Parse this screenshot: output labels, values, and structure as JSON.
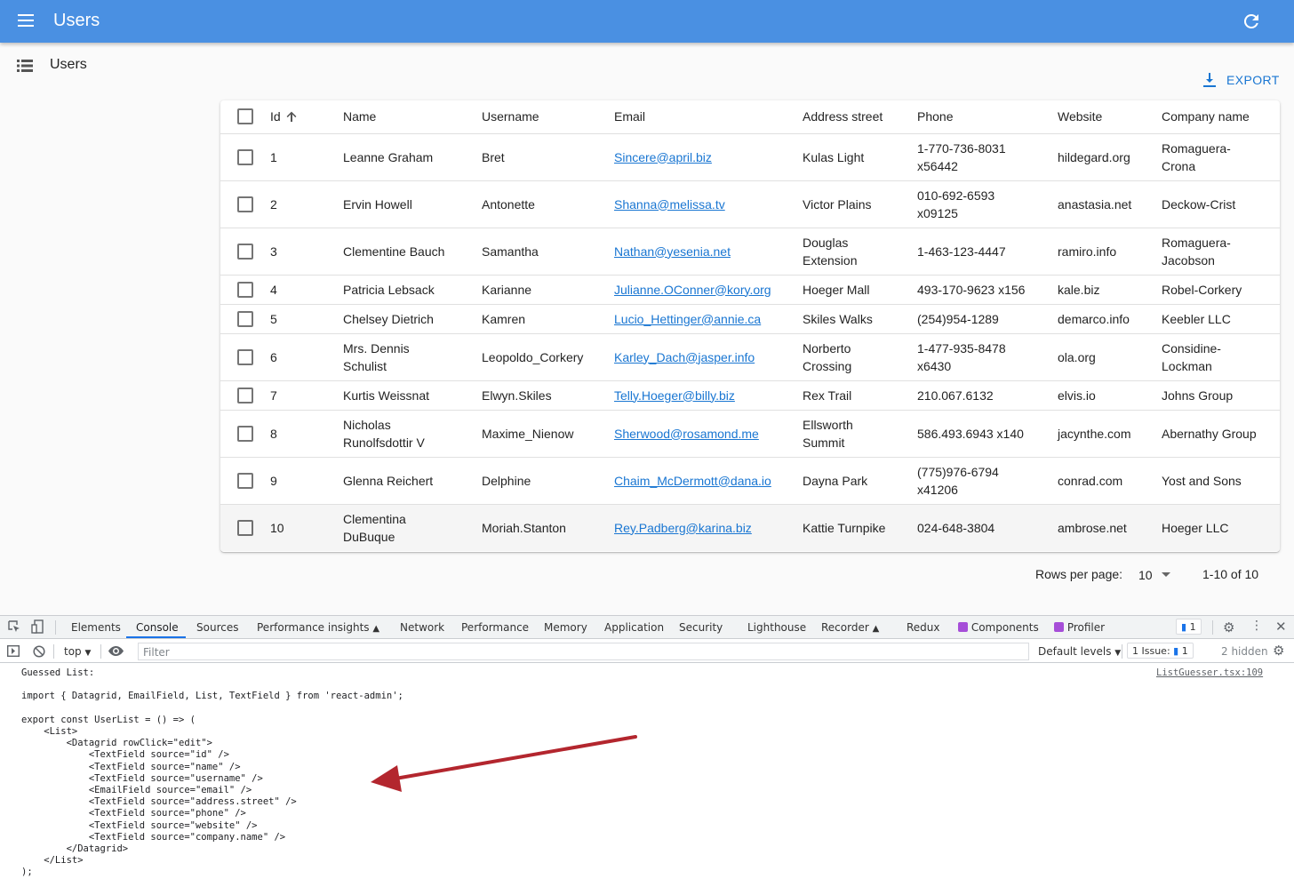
{
  "appbar": {
    "title": "Users",
    "color": "#4a90e2"
  },
  "page": {
    "title": "Users",
    "export_label": "EXPORT"
  },
  "table": {
    "columns": [
      "Id",
      "Name",
      "Username",
      "Email",
      "Address street",
      "Phone",
      "Website",
      "Company name"
    ],
    "rows": [
      {
        "id": "1",
        "name": [
          "Leanne Graham"
        ],
        "username": "Bret",
        "email": "Sincere@april.biz",
        "street": [
          "Kulas Light"
        ],
        "phone": [
          "1-770-736-8031",
          "x56442"
        ],
        "website": "hildegard.org",
        "company": [
          "Romaguera-",
          "Crona"
        ]
      },
      {
        "id": "2",
        "name": [
          "Ervin Howell"
        ],
        "username": "Antonette",
        "email": "Shanna@melissa.tv",
        "street": [
          "Victor Plains"
        ],
        "phone": [
          "010-692-6593",
          "x09125"
        ],
        "website": "anastasia.net",
        "company": [
          "Deckow-Crist"
        ]
      },
      {
        "id": "3",
        "name": [
          "Clementine Bauch"
        ],
        "username": "Samantha",
        "email": "Nathan@yesenia.net",
        "street": [
          "Douglas",
          "Extension"
        ],
        "phone": [
          "1-463-123-4447"
        ],
        "website": "ramiro.info",
        "company": [
          "Romaguera-",
          "Jacobson"
        ]
      },
      {
        "id": "4",
        "name": [
          "Patricia Lebsack"
        ],
        "username": "Karianne",
        "email": "Julianne.OConner@kory.org",
        "street": [
          "Hoeger Mall"
        ],
        "phone": [
          "493-170-9623 x156"
        ],
        "website": "kale.biz",
        "company": [
          "Robel-Corkery"
        ]
      },
      {
        "id": "5",
        "name": [
          "Chelsey Dietrich"
        ],
        "username": "Kamren",
        "email": "Lucio_Hettinger@annie.ca",
        "street": [
          "Skiles Walks"
        ],
        "phone": [
          "(254)954-1289"
        ],
        "website": "demarco.info",
        "company": [
          "Keebler LLC"
        ]
      },
      {
        "id": "6",
        "name": [
          "Mrs. Dennis",
          "Schulist"
        ],
        "username": "Leopoldo_Corkery",
        "email": "Karley_Dach@jasper.info",
        "street": [
          "Norberto",
          "Crossing"
        ],
        "phone": [
          "1-477-935-8478",
          "x6430"
        ],
        "website": "ola.org",
        "company": [
          "Considine-",
          "Lockman"
        ]
      },
      {
        "id": "7",
        "name": [
          "Kurtis Weissnat"
        ],
        "username": "Elwyn.Skiles",
        "email": "Telly.Hoeger@billy.biz",
        "street": [
          "Rex Trail"
        ],
        "phone": [
          "210.067.6132"
        ],
        "website": "elvis.io",
        "company": [
          "Johns Group"
        ]
      },
      {
        "id": "8",
        "name": [
          "Nicholas",
          "Runolfsdottir V"
        ],
        "username": "Maxime_Nienow",
        "email": "Sherwood@rosamond.me",
        "street": [
          "Ellsworth",
          "Summit"
        ],
        "phone": [
          "586.493.6943 x140"
        ],
        "website": "jacynthe.com",
        "company": [
          "Abernathy Group"
        ]
      },
      {
        "id": "9",
        "name": [
          "Glenna Reichert"
        ],
        "username": "Delphine",
        "email": "Chaim_McDermott@dana.io",
        "street": [
          "Dayna Park"
        ],
        "phone": [
          "(775)976-6794",
          "x41206"
        ],
        "website": "conrad.com",
        "company": [
          "Yost and Sons"
        ]
      },
      {
        "id": "10",
        "name": [
          "Clementina",
          "DuBuque"
        ],
        "username": "Moriah.Stanton",
        "email": "Rey.Padberg@karina.biz",
        "street": [
          "Kattie Turnpike"
        ],
        "phone": [
          "024-648-3804"
        ],
        "website": "ambrose.net",
        "company": [
          "Hoeger LLC"
        ]
      }
    ]
  },
  "pagination": {
    "rows_per_page_label": "Rows per page:",
    "rows_per_page_value": "10",
    "range": "1-10 of 10"
  },
  "devtools": {
    "tabs": [
      "Elements",
      "Console",
      "Sources",
      "Performance insights",
      "Network",
      "Performance",
      "Memory",
      "Application",
      "Security",
      "Lighthouse",
      "Recorder",
      "Redux",
      "Components",
      "Profiler"
    ],
    "messages_count": "1",
    "context": "top",
    "filter_placeholder": "Filter",
    "default_levels": "Default levels",
    "issues_label": "1 Issue:",
    "issues_count": "1",
    "hidden": "2 hidden",
    "source_link": "ListGuesser.tsx:109",
    "console_lines": [
      "Guessed List:",
      "",
      "import { Datagrid, EmailField, List, TextField } from 'react-admin';",
      "",
      "export const UserList = () => (",
      "    <List>",
      "        <Datagrid rowClick=\"edit\">",
      "            <TextField source=\"id\" />",
      "            <TextField source=\"name\" />",
      "            <TextField source=\"username\" />",
      "            <EmailField source=\"email\" />",
      "            <TextField source=\"address.street\" />",
      "            <TextField source=\"phone\" />",
      "            <TextField source=\"website\" />",
      "            <TextField source=\"company.name\" />",
      "        </Datagrid>",
      "    </List>",
      ");"
    ],
    "annotation_color": "#b3262e"
  }
}
